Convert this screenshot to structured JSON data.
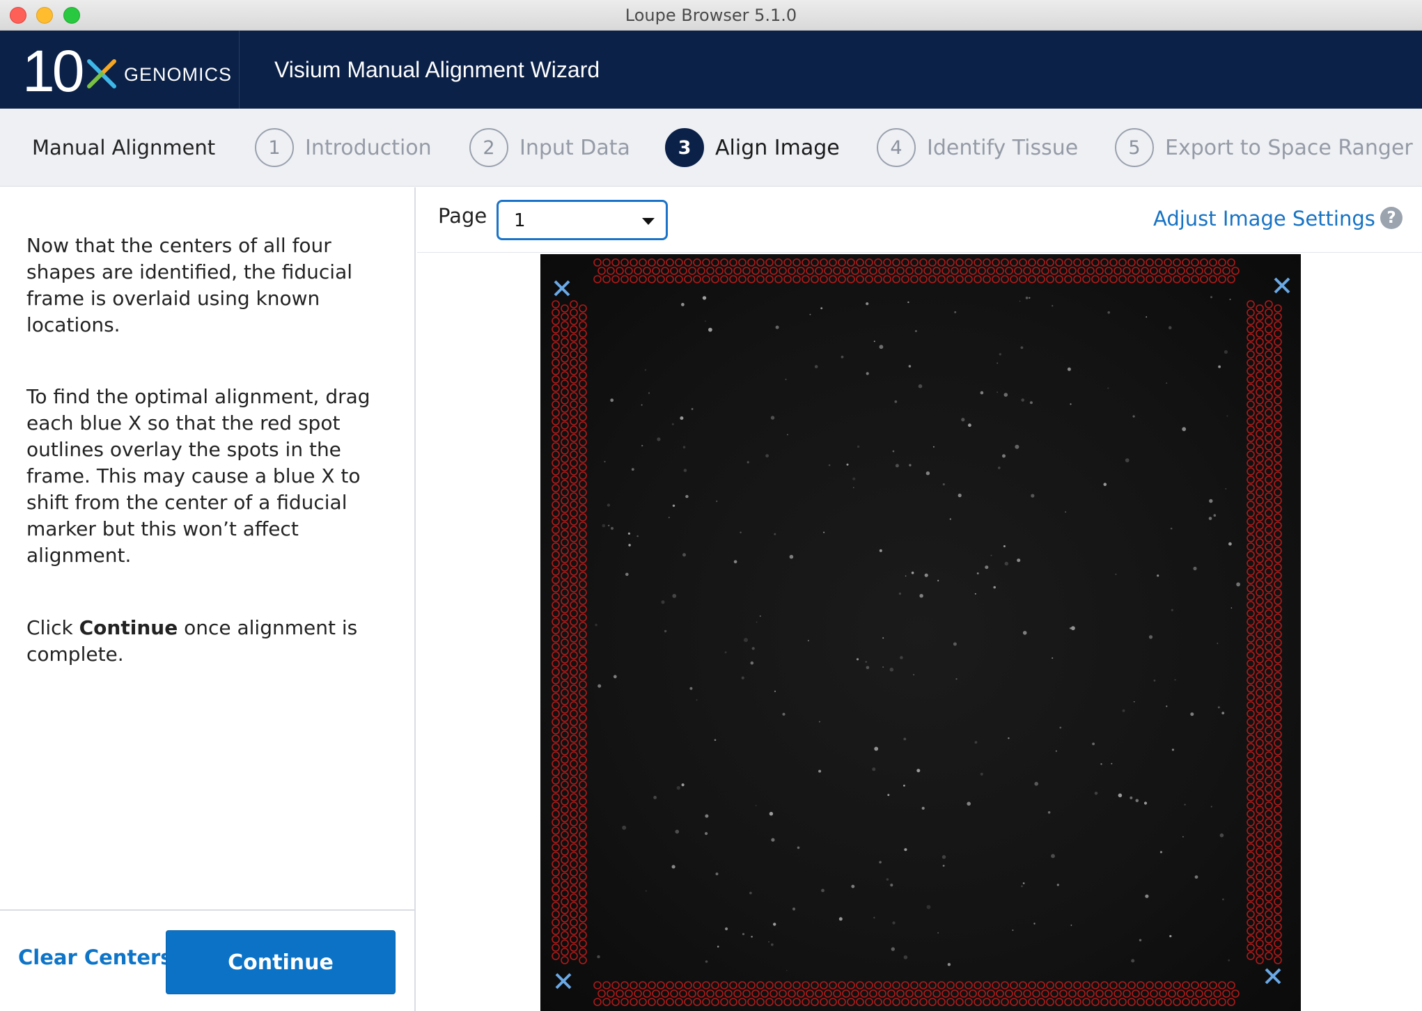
{
  "window": {
    "title": "Loupe Browser 5.1.0"
  },
  "header": {
    "logo_number": "10",
    "logo_text": "GENOMICS",
    "title": "Visium Manual Alignment Wizard"
  },
  "steps": {
    "label": "Manual Alignment",
    "items": [
      {
        "number": "1",
        "label": "Introduction",
        "state": "inactive"
      },
      {
        "number": "2",
        "label": "Input Data",
        "state": "inactive"
      },
      {
        "number": "3",
        "label": "Align Image",
        "state": "active"
      },
      {
        "number": "4",
        "label": "Identify Tissue",
        "state": "inactive"
      },
      {
        "number": "5",
        "label": "Export to Space Ranger",
        "state": "inactive"
      }
    ]
  },
  "instructions": {
    "p1": "Now that the centers of all four shapes are identified, the fiducial frame is overlaid using known locations.",
    "p2": "To find the optimal alignment, drag each blue X so that the red spot outlines overlay the spots in the frame. This may cause a blue X to shift from the center of a fiducial marker but this won’t affect alignment.",
    "p3_prefix": "Click ",
    "p3_bold": "Continue",
    "p3_suffix": " once alignment is complete."
  },
  "footer": {
    "clear_label": "Clear Centers",
    "continue_label": "Continue"
  },
  "toolbar": {
    "page_label": "Page",
    "page_value": "1",
    "adjust_label": "Adjust Image Settings",
    "help_glyph": "?"
  },
  "colors": {
    "header_bg": "#0b2148",
    "accent_blue": "#0b72c6",
    "link_blue": "#1672c4",
    "fiducial_red": "#d01c1c",
    "handle_blue": "#6aa9e6"
  },
  "icons": {
    "logo_x": "10x-x-logo-icon",
    "caret": "chevron-down-icon",
    "help": "question-circle-icon",
    "handle": "x-handle-icon"
  }
}
